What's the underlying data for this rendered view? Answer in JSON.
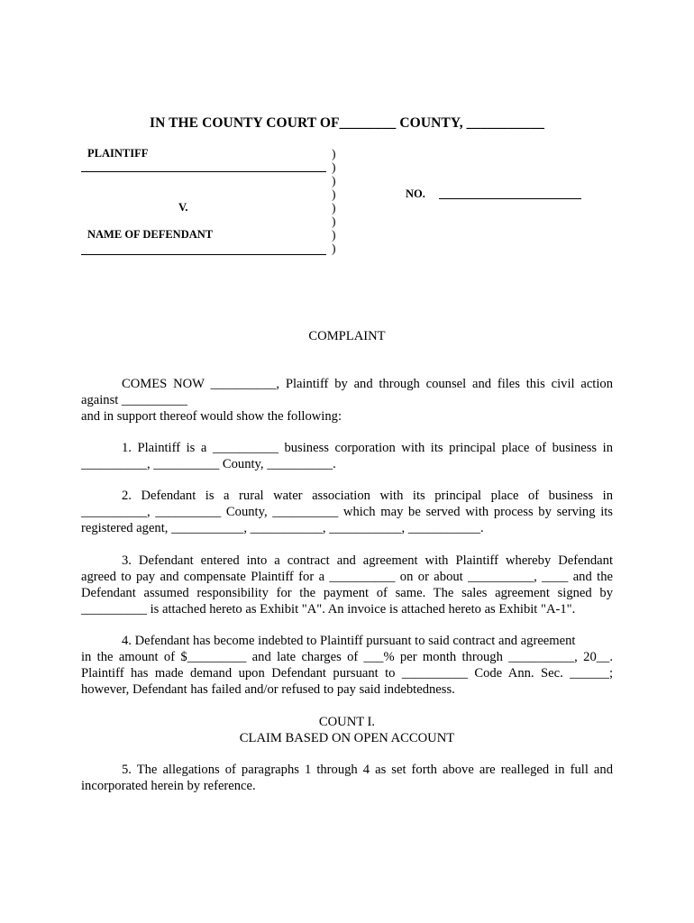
{
  "caption": {
    "title": "IN THE COUNTY COURT OF________ COUNTY, ___________",
    "plaintiff_label": "PLAINTIFF",
    "versus_label": "V.",
    "defendant_label": "NAME OF DEFENDANT",
    "number_label": "NO.",
    "parens": [
      ")",
      ")",
      ")",
      ")",
      ")",
      ")",
      ")",
      ")"
    ]
  },
  "document_title": "COMPLAINT",
  "intro": {
    "line1": "COMES NOW __________, Plaintiff by and through counsel and files this civil action",
    "line2": "against __________",
    "line3": "and in support thereof would show the following:"
  },
  "paragraphs": {
    "p1": {
      "line1": "1.   Plaintiff is a __________ business corporation with its principal place of business in",
      "line2": "__________, __________ County, __________."
    },
    "p2": {
      "line1": "2.     Defendant is a rural water association with its principal place of business in",
      "line2": "__________, __________ County, __________ which may be served with process by serving its",
      "line3": "registered agent, ___________, ___________, ___________, ___________."
    },
    "p3": {
      "line1": "3.   Defendant entered into a contract and agreement with Plaintiff whereby Defendant",
      "line2": "agreed to pay and compensate Plaintiff for a __________ on or about __________, ____ and the",
      "line3": "Defendant assumed responsibility for the payment of same.  The sales agreement signed by",
      "line4": "__________ is attached hereto as Exhibit \"A\".  An invoice is attached hereto as Exhibit \"A-1\"."
    },
    "p4": {
      "line1": "4.  Defendant has become indebted to Plaintiff pursuant to said contract and agreement",
      "line2": "in the amount of $_________  and late charges of ___% per month through __________, 20__.",
      "line3": "Plaintiff has made demand upon Defendant pursuant to __________ Code Ann. Sec. ______;",
      "line4": "however, Defendant has failed and/or refused to pay said indebtedness."
    },
    "count": {
      "heading": "COUNT I.",
      "subheading": "CLAIM BASED ON OPEN ACCOUNT"
    },
    "p5": {
      "line1": "5.   The allegations of paragraphs 1 through 4 as set forth above are realleged in full and",
      "line2": "incorporated herein by reference."
    }
  }
}
